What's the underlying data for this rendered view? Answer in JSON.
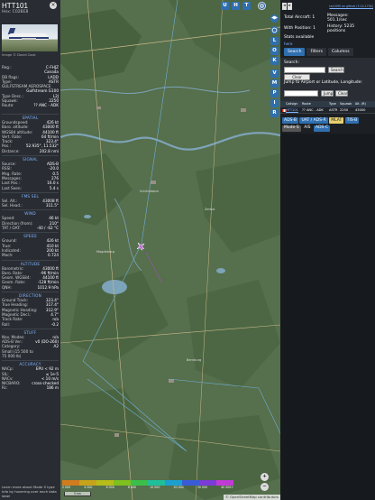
{
  "info": {
    "callsign": "HTT101",
    "hex": "Hex: C02BE8",
    "photo_credit": "Image © David Cook",
    "reg_rows": [
      {
        "k": "Reg.:",
        "v": "C-FHJZ"
      },
      {
        "k": "",
        "v": "Canada"
      },
      {
        "k": "DB flags:",
        "v": "LADD"
      },
      {
        "k": "Type:",
        "v": "ASTR"
      },
      {
        "k": "GULFSTREAM AEROSPACE",
        "v": ""
      },
      {
        "k": "",
        "v": "Gulfstream G100"
      },
      {
        "k": "Type Desc.:",
        "v": "L2J"
      },
      {
        "k": "Squawk:",
        "v": "2250"
      },
      {
        "k": "Route:",
        "v": "?? ANC - ADK"
      }
    ],
    "sections": [
      {
        "title": "SPATIAL",
        "rows": [
          {
            "k": "Groundspeed:",
            "v": "426 kt"
          },
          {
            "k": "Baro. altitude:",
            "v": "43000 ft"
          },
          {
            "k": "WGS84 altitude:",
            "v": "44100 ft"
          },
          {
            "k": "Vert. Rate:",
            "v": "64 ft/min"
          },
          {
            "k": "Track:",
            "v": "323.4°"
          },
          {
            "k": "Pos.:",
            "v": "52.935°, 11.532°"
          },
          {
            "k": "Distance:",
            "v": "202.8 nmi"
          }
        ]
      },
      {
        "title": "SIGNAL",
        "rows": [
          {
            "k": "Source:",
            "v": "ADS-B"
          },
          {
            "k": "RSSI:",
            "v": "-20.0"
          },
          {
            "k": "Msg. Rate:",
            "v": "0.5"
          },
          {
            "k": "Messages:",
            "v": "276"
          },
          {
            "k": "Last Pos.:",
            "v": "16.0 s"
          },
          {
            "k": "Last Seen:",
            "v": "5.4 s"
          }
        ]
      },
      {
        "title": "FMS SEL",
        "rows": [
          {
            "k": "Sel. Alt.:",
            "v": "43008 ft"
          },
          {
            "k": "Sel. Head.:",
            "v": "311.5°"
          }
        ]
      },
      {
        "title": "WIND",
        "rows": [
          {
            "k": "Speed:",
            "v": "46 kt"
          },
          {
            "k": "Direction (from):",
            "v": "210°"
          },
          {
            "k": "TAT / OAT:",
            "v": "-40 / -62 °C"
          }
        ]
      },
      {
        "title": "SPEED",
        "rows": [
          {
            "k": "Ground:",
            "v": "426 kt"
          },
          {
            "k": "True:",
            "v": "410 kt"
          },
          {
            "k": "Indicated:",
            "v": "200 kt"
          },
          {
            "k": "Mach:",
            "v": "0.724"
          }
        ]
      },
      {
        "title": "ALTITUDE",
        "rows": [
          {
            "k": "Barometric:",
            "v": "43000 ft"
          },
          {
            "k": "Baro. Rate:",
            "v": "-96 ft/min"
          },
          {
            "k": "Geom. WGS84:",
            "v": "44100 ft"
          },
          {
            "k": "Geom. Rate:",
            "v": "-128 ft/min"
          },
          {
            "k": "QNH:",
            "v": "1012.9 hPa"
          }
        ]
      },
      {
        "title": "DIRECTION",
        "rows": [
          {
            "k": "Ground Track:",
            "v": "323.4°"
          },
          {
            "k": "True Heading:",
            "v": "317.4°"
          },
          {
            "k": "Magnetic Heading:",
            "v": "312.9°"
          },
          {
            "k": "Magnetic Decl.:",
            "v": "4.7°"
          },
          {
            "k": "Track Rate:",
            "v": "n/a"
          },
          {
            "k": "Roll:",
            "v": "-0.2"
          }
        ]
      },
      {
        "title": "STUFF",
        "rows": [
          {
            "k": "Nav. Modes:",
            "v": "n/a"
          },
          {
            "k": "ADS-B Ver.:",
            "v": "v0 (DO-260)"
          },
          {
            "k": "Category:",
            "v": "A2"
          },
          {
            "k": "Small (15 500 to",
            "v": ""
          },
          {
            "k": "75 000 lb)",
            "v": ""
          }
        ]
      },
      {
        "title": "ACCURACY",
        "rows": [
          {
            "k": "NACp:",
            "v": "EPU < 92 m"
          },
          {
            "k": "SIL:",
            "v": "≤ 1e-5"
          },
          {
            "k": "NACv:",
            "v": "< 10 m/s"
          },
          {
            "k": "NICBARO:",
            "v": "cross-checked"
          },
          {
            "k": "Rc:",
            "v": "186 m"
          }
        ]
      }
    ],
    "footer": "Learn more about Mode S type info by hovering over each data label"
  },
  "map": {
    "buttons_top": [
      "U",
      "H",
      "T"
    ],
    "buttons_side": [
      "L",
      "O",
      "K",
      "V",
      "M",
      "P",
      "I",
      "R"
    ],
    "legend_labels": [
      "2 000",
      "4 000",
      "6 000",
      "8 000",
      "10 000",
      "20 000",
      "30 000",
      "40 000+"
    ],
    "legend_colors": [
      "#d07c1f",
      "#c7a31b",
      "#b5bd1a",
      "#7fbf1f",
      "#3bbf4a",
      "#1fbf9a",
      "#1b9fd1",
      "#3a5bd6",
      "#7a3bd6",
      "#c03bd6"
    ],
    "scale_text": "5 km",
    "attribution": "© OpenStreetMap contributors"
  },
  "panel": {
    "version_link": "tar1090 on github (3.14.1702)",
    "total_label": "Total Aircraft: 1",
    "messages_label": "Messages:",
    "messages_value": "501.1/sec",
    "position_label": "With Position: 1",
    "history_label": "History: 5235",
    "history_value": "positions",
    "stats_label": "Stats available",
    "stats_link": "here",
    "tabs": [
      "Search",
      "Filters",
      "Columns"
    ],
    "search_label": "Search:",
    "search_btn": "Search",
    "clear_btn": "Clear Search",
    "jump_label": "Jump to Airport or Latitude, Longitude:",
    "jump_btn": "Jump",
    "jump_clear_btn": "Clear",
    "table_headers": [
      "Callsign",
      "Route",
      "Type",
      "Squawk",
      "Alt. (ft)"
    ],
    "table_row": [
      "HTT101",
      "?? ANC - ADK",
      "ASTR",
      "2250",
      "43000"
    ],
    "filter_chips": [
      "ADS-B",
      "UAT / ADS-R",
      "MLAT",
      "TIS-B",
      "Mode-S",
      "AIS",
      "ADS-C"
    ]
  }
}
